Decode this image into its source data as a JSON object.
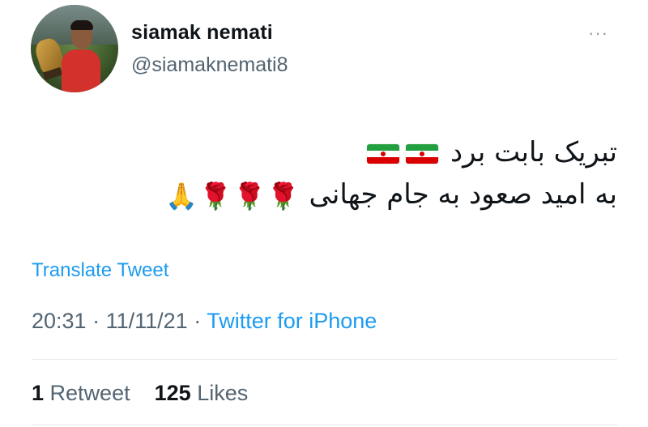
{
  "user": {
    "name": "siamak nemati",
    "handle": "@siamaknemati8"
  },
  "more_icon": "···",
  "tweet": {
    "line1": {
      "text": "تبریک بابت برد",
      "flags": 2
    },
    "line2": {
      "text": "به امید صعود به جام جهانی",
      "roses": 3,
      "pray": 1
    }
  },
  "translate_label": "Translate Tweet",
  "meta": {
    "time": "20:31",
    "date": "11/11/21",
    "separator": "·",
    "source": "Twitter for iPhone"
  },
  "stats": {
    "retweets_count": "1",
    "retweets_label": "Retweet",
    "likes_count": "125",
    "likes_label": "Likes"
  },
  "colors": {
    "accent": "#1d9bf0",
    "secondary_text": "#536471",
    "primary_text": "#0f1419",
    "flag_green": "#239f40",
    "flag_red": "#da0000"
  },
  "icons": [
    "more-icon",
    "iran-flag-icon",
    "rose-icon",
    "folded-hands-icon"
  ]
}
